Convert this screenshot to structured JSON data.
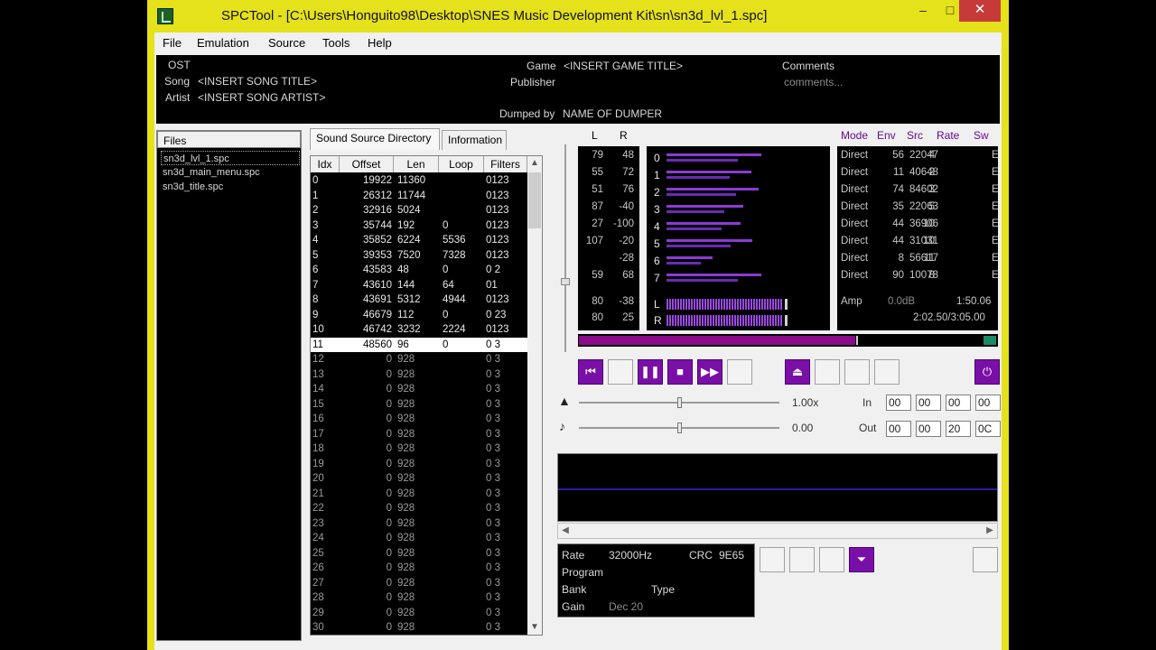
{
  "window": {
    "title": "SPCTool - [C:\\Users\\Honguito98\\Desktop\\SNES Music Development Kit\\sn\\sn3d_lvl_1.spc]",
    "minimize": "–",
    "maximize": "□",
    "close": "✕"
  },
  "menu": [
    "File",
    "Emulation",
    "Source",
    "Tools",
    "Help"
  ],
  "info": {
    "ost_label": "OST",
    "song_label": "Song",
    "song_value": "<INSERT SONG TITLE>",
    "artist_label": "Artist",
    "artist_value": "<INSERT SONG ARTIST>",
    "game_label": "Game",
    "game_value": "<INSERT GAME TITLE>",
    "publisher_label": "Publisher",
    "comments_label": "Comments",
    "comments_value": "comments...",
    "dumped_label": "Dumped by",
    "dumped_value": "NAME OF DUMPER"
  },
  "files": {
    "header": "Files",
    "items": [
      "sn3d_lvl_1.spc",
      "sn3d_main_menu.spc",
      "sn3d_title.spc"
    ]
  },
  "tabs": [
    "Sound Source Directory",
    "Information"
  ],
  "source_table": {
    "columns": [
      "Idx",
      "Offset",
      "Len",
      "Loop",
      "Filters"
    ],
    "rows": [
      [
        "0",
        "19922",
        "11360",
        "",
        "0123"
      ],
      [
        "1",
        "26312",
        "11744",
        "",
        "0123"
      ],
      [
        "2",
        "32916",
        "5024",
        "",
        "0123"
      ],
      [
        "3",
        "35744",
        "192",
        "0",
        "0123"
      ],
      [
        "4",
        "35852",
        "6224",
        "5536",
        "0123"
      ],
      [
        "5",
        "39353",
        "7520",
        "7328",
        "0123"
      ],
      [
        "6",
        "43583",
        "48",
        "0",
        "0 2"
      ],
      [
        "7",
        "43610",
        "144",
        "64",
        "01"
      ],
      [
        "8",
        "43691",
        "5312",
        "4944",
        "0123"
      ],
      [
        "9",
        "46679",
        "112",
        "0",
        "0 23"
      ],
      [
        "10",
        "46742",
        "3232",
        "2224",
        "0123"
      ],
      [
        "11",
        "48560",
        "96",
        "0",
        "0 3"
      ],
      [
        "12",
        "0",
        "928",
        "",
        "0 3"
      ],
      [
        "13",
        "0",
        "928",
        "",
        "0 3"
      ],
      [
        "14",
        "0",
        "928",
        "",
        "0 3"
      ],
      [
        "15",
        "0",
        "928",
        "",
        "0 3"
      ],
      [
        "16",
        "0",
        "928",
        "",
        "0 3"
      ],
      [
        "17",
        "0",
        "928",
        "",
        "0 3"
      ],
      [
        "18",
        "0",
        "928",
        "",
        "0 3"
      ],
      [
        "19",
        "0",
        "928",
        "",
        "0 3"
      ],
      [
        "20",
        "0",
        "928",
        "",
        "0 3"
      ],
      [
        "21",
        "0",
        "928",
        "",
        "0 3"
      ],
      [
        "22",
        "0",
        "928",
        "",
        "0 3"
      ],
      [
        "23",
        "0",
        "928",
        "",
        "0 3"
      ],
      [
        "24",
        "0",
        "928",
        "",
        "0 3"
      ],
      [
        "25",
        "0",
        "928",
        "",
        "0 3"
      ],
      [
        "26",
        "0",
        "928",
        "",
        "0 3"
      ],
      [
        "27",
        "0",
        "928",
        "",
        "0 3"
      ],
      [
        "28",
        "0",
        "928",
        "",
        "0 3"
      ],
      [
        "29",
        "0",
        "928",
        "",
        "0 3"
      ],
      [
        "30",
        "0",
        "928",
        "",
        "0 3"
      ]
    ],
    "selected_index": 11
  },
  "mixer": {
    "lr_headers": [
      "L",
      "R"
    ],
    "lr_values": [
      [
        "79",
        "48"
      ],
      [
        "55",
        "72"
      ],
      [
        "51",
        "76"
      ],
      [
        "87",
        "-40"
      ],
      [
        "27",
        "-100"
      ],
      [
        "107",
        "-20"
      ],
      [
        "",
        "-28"
      ],
      [
        "59",
        "68"
      ]
    ],
    "lr_master": [
      [
        "80",
        "-38"
      ],
      [
        "80",
        "25"
      ]
    ],
    "voice_labels": [
      "0",
      "1",
      "2",
      "3",
      "4",
      "5",
      "6",
      "7"
    ],
    "voice_levels": [
      0.62,
      0.55,
      0.6,
      0.5,
      0.48,
      0.56,
      0.3,
      0.62
    ],
    "master_labels": [
      "L",
      "R"
    ],
    "master_levels": [
      0.76,
      0.76
    ],
    "mode_headers": [
      "Mode",
      "Env",
      "Src",
      "Rate",
      "Sw"
    ],
    "mode_rows": [
      [
        "Direct",
        "56",
        "4",
        "22047",
        "E"
      ],
      [
        "Direct",
        "11",
        "2",
        "40648",
        "E"
      ],
      [
        "Direct",
        "74",
        "3",
        "84602",
        "E"
      ],
      [
        "Direct",
        "35",
        "5",
        "22063",
        "E"
      ],
      [
        "Direct",
        "44",
        "10",
        "36906",
        "E"
      ],
      [
        "Direct",
        "44",
        "10",
        "31031",
        "E"
      ],
      [
        "Direct",
        "8",
        "11",
        "56617",
        "E"
      ],
      [
        "Direct",
        "90",
        "8",
        "10078",
        "E"
      ]
    ],
    "amp_label": "Amp",
    "amp_value": "0.0dB",
    "time_a": "1:50.06",
    "time_b": "2:02.50/3:05.00"
  },
  "playback": {
    "progress": 0.66,
    "speed_value": "1.00x",
    "pitch_value": "0.00",
    "speed_level": 0.5,
    "pitch_level": 0.5,
    "in_label": "In",
    "out_label": "Out",
    "in_times": [
      "00",
      "00",
      "00",
      "00"
    ],
    "out_times": [
      "00",
      "00",
      "20",
      "0C"
    ]
  },
  "sample_info": {
    "rate_label": "Rate",
    "rate_value": "32000Hz",
    "crc_label": "CRC",
    "crc_value": "9E65",
    "program_label": "Program",
    "bank_label": "Bank",
    "type_label": "Type",
    "gain_label": "Gain",
    "gain_value": "Dec 20"
  },
  "colors": {
    "accent": "#7a0fa8",
    "titlebar": "#e5e11b",
    "bar": "#8c3ad6"
  }
}
